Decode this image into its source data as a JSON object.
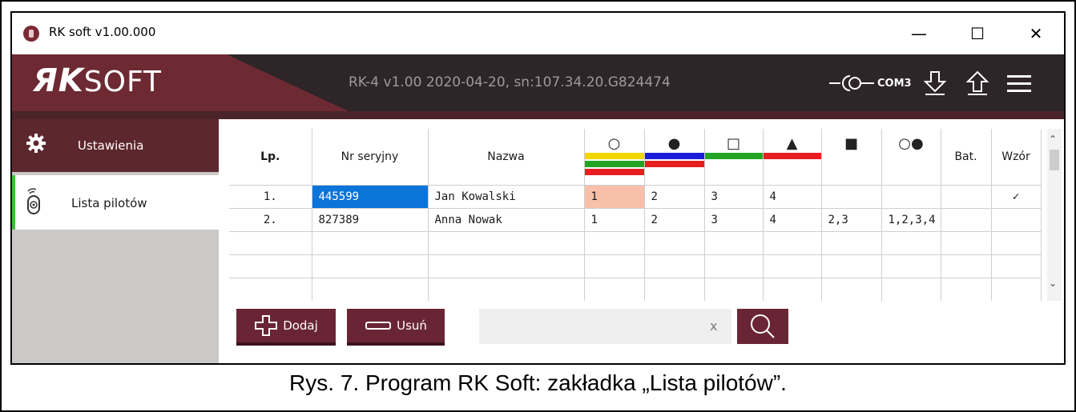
{
  "window": {
    "title": "RK soft v1.00.000",
    "minimize_glyph": "—",
    "maximize_glyph": "☐",
    "close_glyph": "✕"
  },
  "header": {
    "logo_rk": "ЯK",
    "logo_soft": "SOFT",
    "device_info": "RK-4 v1.00 2020-04-20, sn:107.34.20.G824474",
    "port_label": "COM3",
    "icons": [
      "port-connection-icon",
      "download-icon",
      "upload-icon",
      "menu-icon"
    ]
  },
  "sidebar": {
    "items": [
      {
        "label": "Ustawienia",
        "icon": "gear-icon"
      },
      {
        "label": "Lista pilotów",
        "icon": "remote-icon"
      }
    ]
  },
  "table": {
    "headers": {
      "lp": "Lp.",
      "serial": "Nr seryjny",
      "name": "Nazwa",
      "b1_symbol": "○",
      "b2_symbol": "●",
      "b3_symbol": "□",
      "b4_symbol": "▲",
      "b5_symbol": "■",
      "b6_symbol": "○●",
      "battery": "Bat.",
      "template": "Wzór"
    },
    "rows": [
      {
        "lp": "1.",
        "serial": "445599",
        "name": "Jan Kowalski",
        "b1": "1",
        "b2": "2",
        "b3": "3",
        "b4": "4",
        "b5": "",
        "b6": "",
        "bat": "",
        "template": "✓"
      },
      {
        "lp": "2.",
        "serial": "827389",
        "name": "Anna Nowak",
        "b1": "1",
        "b2": "2",
        "b3": "3",
        "b4": "4",
        "b5": "2,3",
        "b6": "1,2,3,4",
        "bat": "",
        "template": ""
      }
    ]
  },
  "toolbar": {
    "add_label": "Dodaj",
    "delete_label": "Usuń",
    "search_value": "",
    "search_clear": "x"
  },
  "colors": {
    "brand": "#6a2535",
    "header_bg": "#2d2528",
    "active_indicator": "#3fbf3f",
    "selected_cell": "#0a74d8",
    "highlight_cell": "#f8c0a8",
    "bar_yellow": "#f2d600",
    "bar_green": "#23a523",
    "bar_red": "#e51f1f",
    "bar_blue": "#1c1cd8"
  },
  "caption": "Rys. 7. Program RK Soft: zakładka „Lista pilotów”."
}
